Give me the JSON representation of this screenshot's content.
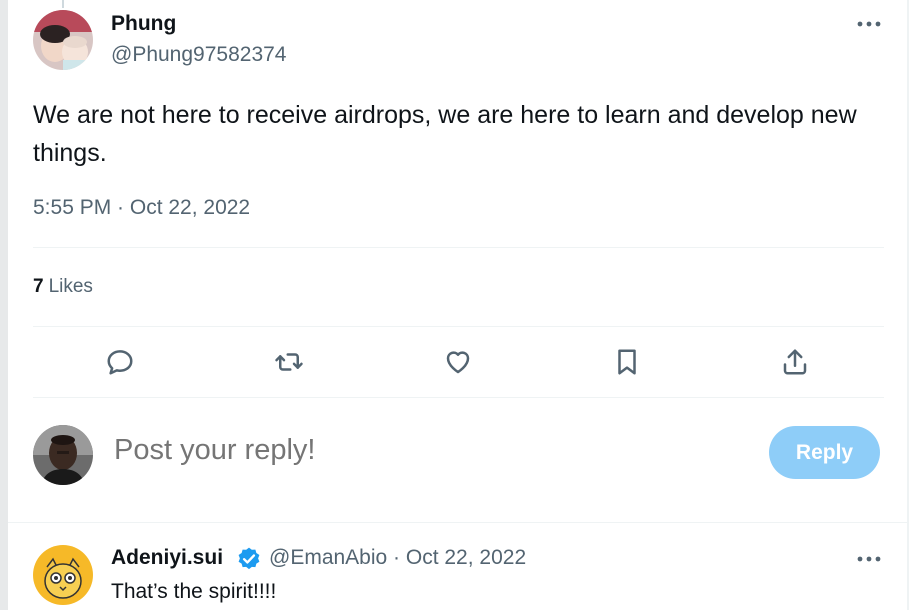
{
  "tweet": {
    "author_name": "Phung",
    "author_handle": "@Phung97582374",
    "text": "We are not here to receive airdrops, we are here to learn and develop new things.",
    "timestamp": "5:55 PM · Oct 22, 2022",
    "likes_count": "7",
    "likes_label": "Likes",
    "more_icon": "more-horizontal-icon"
  },
  "actions": [
    {
      "name": "reply",
      "icon": "comment-icon"
    },
    {
      "name": "retweet",
      "icon": "retweet-icon"
    },
    {
      "name": "like",
      "icon": "heart-icon"
    },
    {
      "name": "bookmark",
      "icon": "bookmark-icon"
    },
    {
      "name": "share",
      "icon": "share-icon"
    }
  ],
  "composer": {
    "placeholder": "Post your reply!",
    "button_label": "Reply"
  },
  "reply": {
    "author_name": "Adeniyi.sui",
    "verified": true,
    "author_handle": "@EmanAbio · Oct 22, 2022",
    "text": "That’s the spirit!!!!"
  },
  "colors": {
    "text": "#0f1419",
    "muted": "#536471",
    "reply_button": "#8ecdf8",
    "verified": "#1d9bf0"
  }
}
